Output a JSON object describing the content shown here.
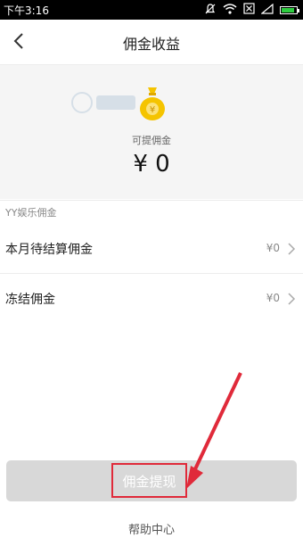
{
  "status_bar": {
    "time": "下午3:16",
    "battery_level": 0.85
  },
  "header": {
    "title": "佣金收益"
  },
  "summary": {
    "withdrawable_label": "可提佣金",
    "withdrawable_amount": "¥ 0"
  },
  "section": {
    "title": "YY娱乐佣金"
  },
  "rows": [
    {
      "label": "本月待结算佣金",
      "value": "¥0"
    },
    {
      "label": "冻结佣金",
      "value": "¥0"
    }
  ],
  "actions": {
    "withdraw_label": "佣金提现",
    "help_label": "帮助中心"
  },
  "colors": {
    "accent_gold": "#f5c400",
    "annotation_red": "#e02a3a",
    "button_disabled": "#d8d8d8"
  },
  "icons": [
    "silent-icon",
    "wifi-icon",
    "no-sim-icon",
    "signal-icon",
    "battery-icon",
    "back-arrow-icon",
    "money-bag-icon",
    "chevron-right-icon"
  ]
}
